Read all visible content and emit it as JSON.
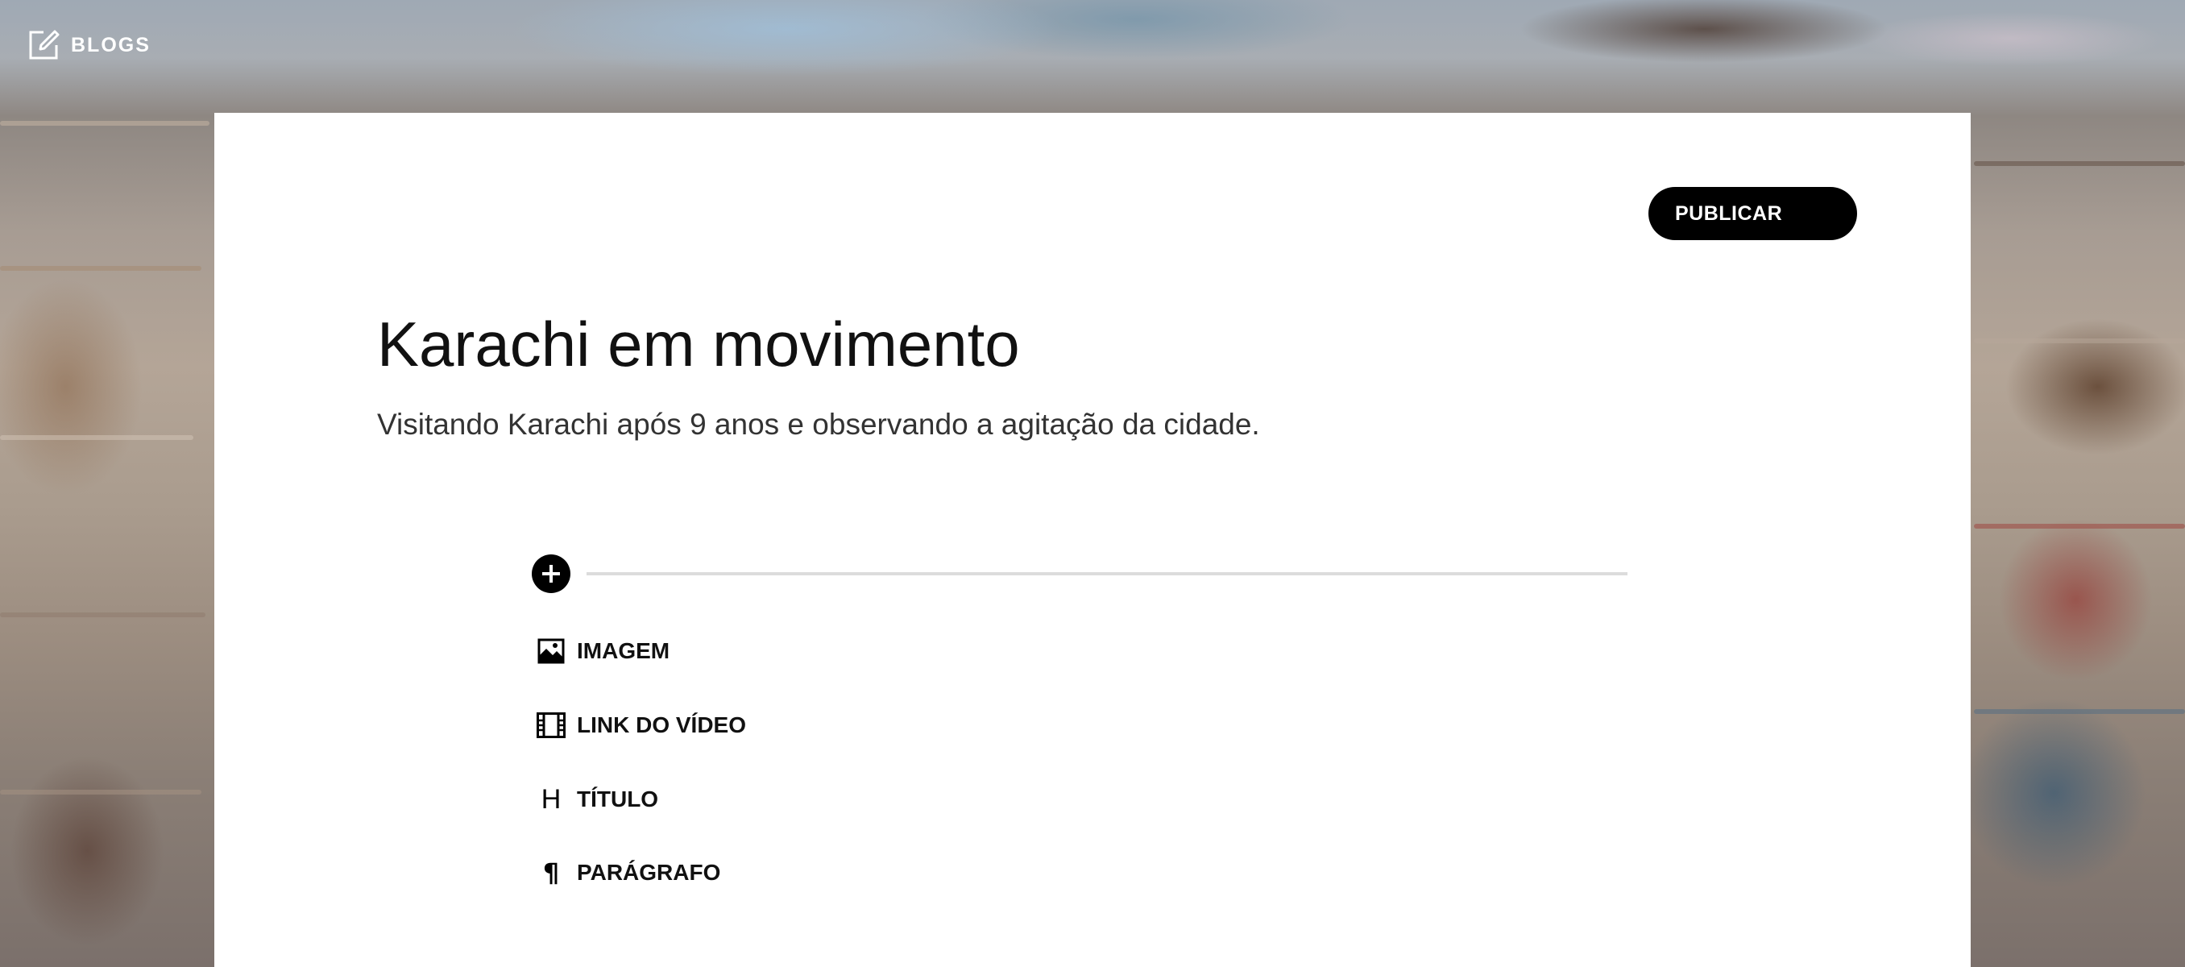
{
  "app": {
    "nav_label": "BLOGS",
    "nav_icon": "edit-icon"
  },
  "editor": {
    "publish_label": "PUBLICAR",
    "title": "Karachi em movimento",
    "subtitle": "Visitando Karachi após 9 anos e observando a agitação da cidade.",
    "add_icon": "plus-circle-icon"
  },
  "block_menu": {
    "items": [
      {
        "label": "IMAGEM",
        "icon": "image-icon"
      },
      {
        "label": "LINK DO VÍDEO",
        "icon": "film-icon"
      },
      {
        "label": "TÍTULO",
        "icon": "heading-icon"
      },
      {
        "label": "PARÁGRAFO",
        "icon": "paragraph-icon"
      }
    ]
  },
  "colors": {
    "accent": "#000000",
    "card": "#ffffff",
    "divider": "#dcdcdc",
    "nav_text": "#ffffff"
  }
}
